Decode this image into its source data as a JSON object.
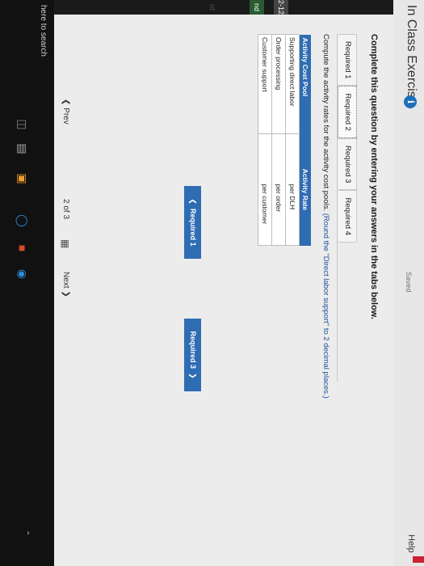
{
  "header": {
    "title": "In Class Exercise",
    "info_glyph": "i",
    "saved": "Saved",
    "help": "Help"
  },
  "left_strip": [
    "2-12",
    "nd",
    "nt"
  ],
  "instruction": "Complete this question by entering your answers in the tabs below.",
  "tabs": [
    {
      "label": "Required 1",
      "active": false
    },
    {
      "label": "Required 2",
      "active": true
    },
    {
      "label": "Required 3",
      "active": false
    },
    {
      "label": "Required 4",
      "active": false
    }
  ],
  "compute": {
    "text": "Compute the activity rates for the activity cost pools.",
    "note": "(Round the \"Direct labor support\" to 2 decimal places.)"
  },
  "table": {
    "headers": [
      "Activity Cost Pool",
      "Activity Rate"
    ],
    "rows": [
      {
        "pool": "Supporting direct labor",
        "unit": "per DLH"
      },
      {
        "pool": "Order processing",
        "unit": "per order"
      },
      {
        "pool": "Customer support",
        "unit": "per customer"
      }
    ]
  },
  "nav_buttons": {
    "prev_label": "Required 1",
    "next_label": "Required 3"
  },
  "pager": {
    "prev": "Prev",
    "page": "2",
    "of": "of",
    "total": "3",
    "next": "Next"
  },
  "taskbar": {
    "search": "here to search"
  },
  "colors": {
    "accent": "#2f6db3",
    "text": "#222222",
    "note": "#1c4f9c"
  }
}
